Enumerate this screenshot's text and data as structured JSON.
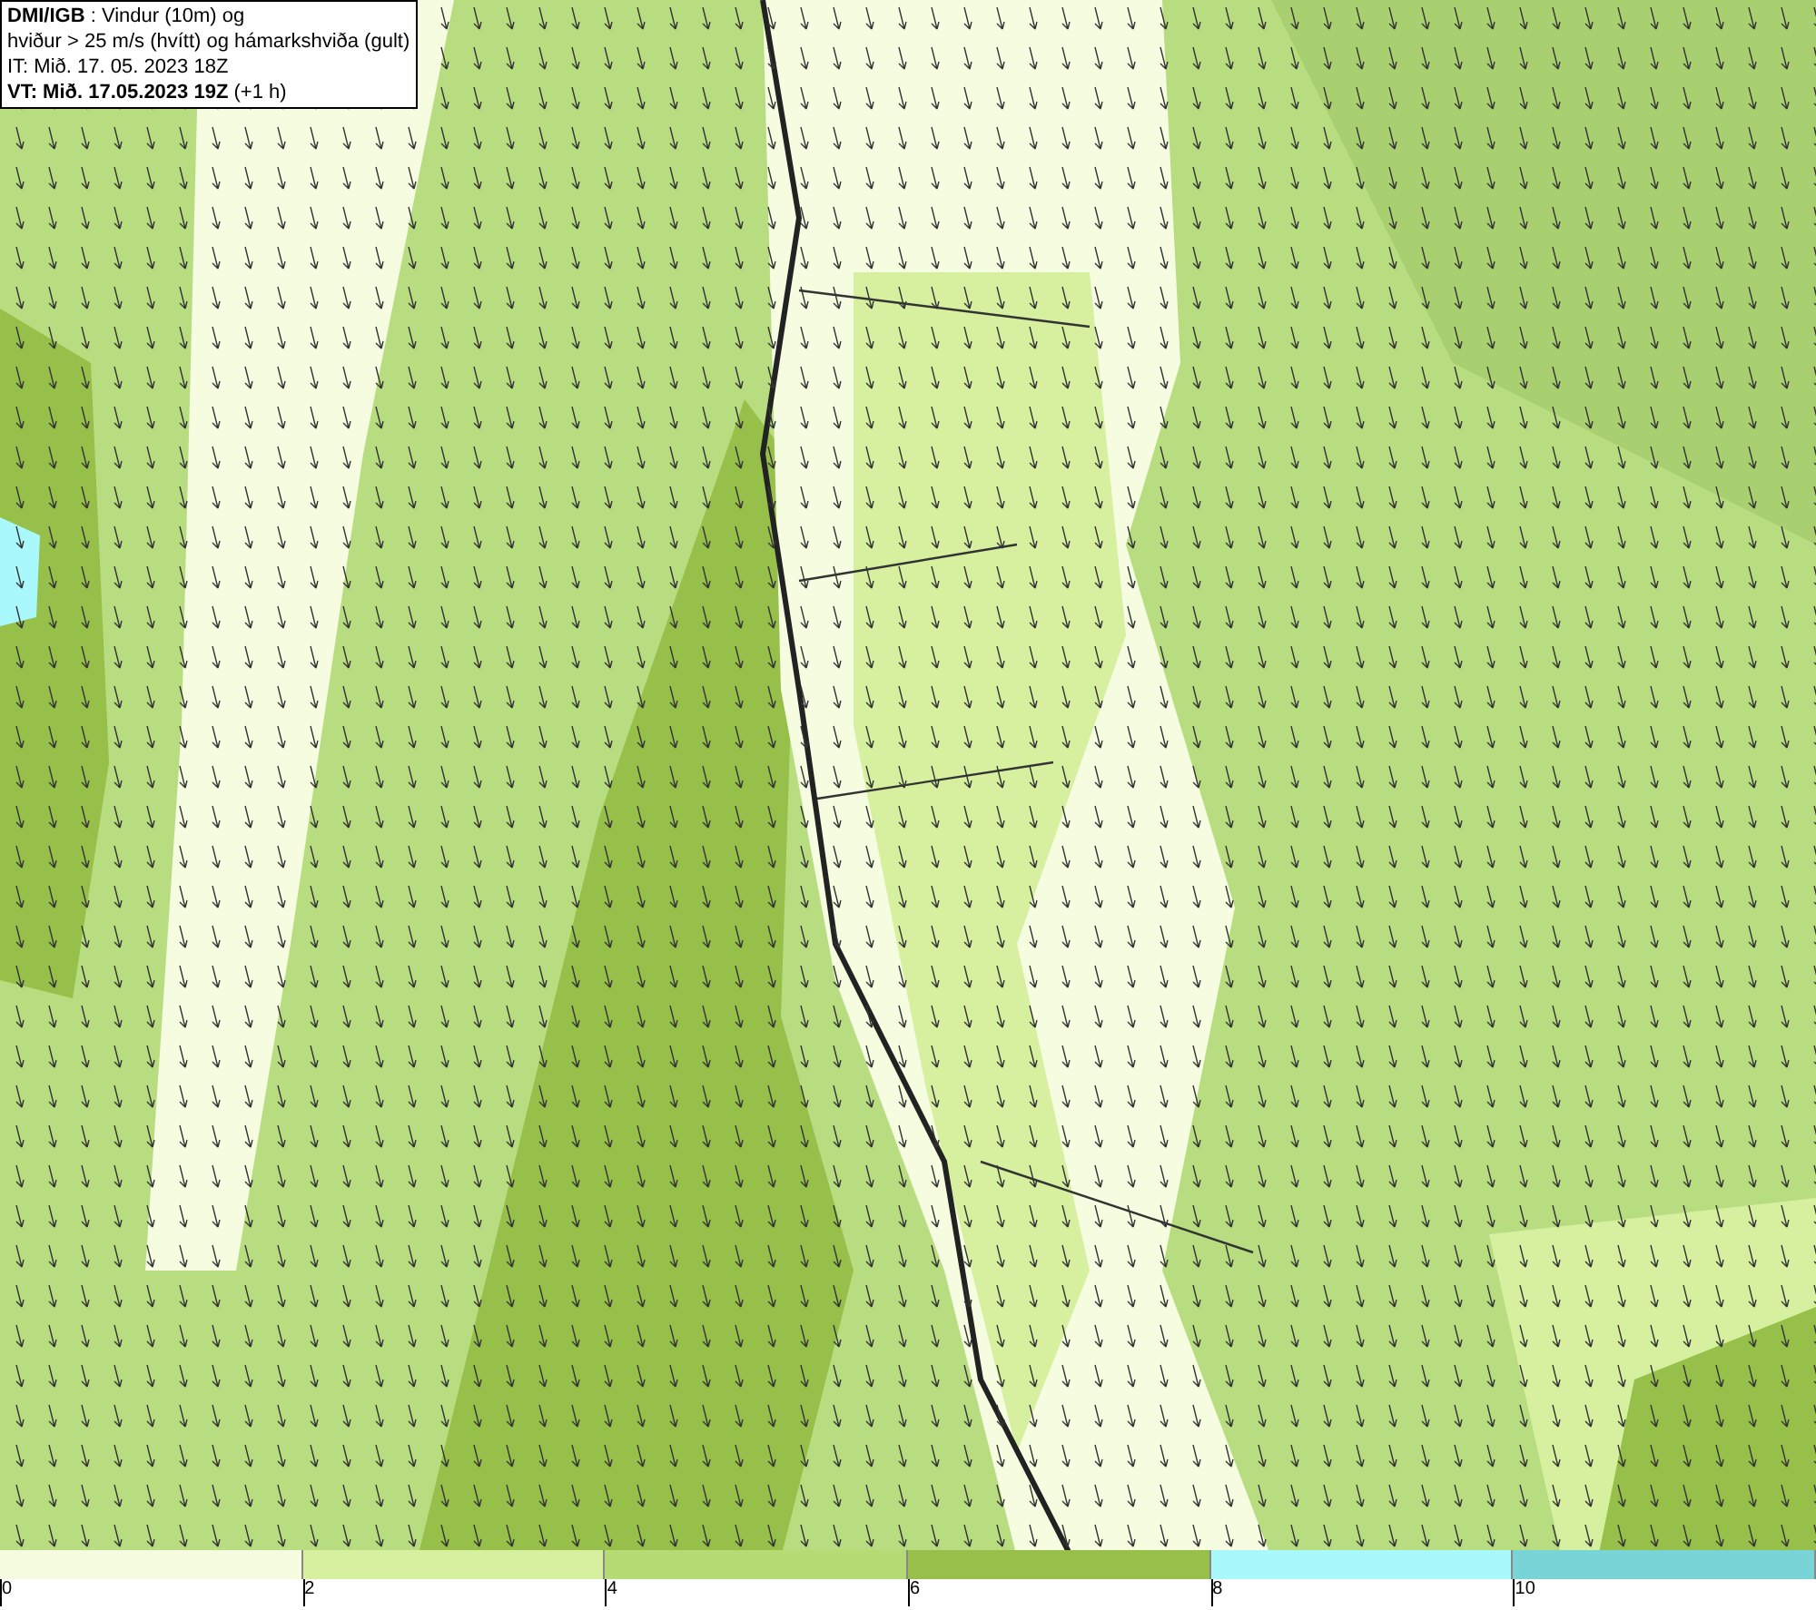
{
  "title_box": {
    "lines": [
      "**DMI/IGB** : Vindur (10m) og",
      "hviður > 25 m/s (hvítt) og hámarkshviða (gult)",
      "IT: Mið. 17. 05. 2023 18Z",
      "**VT: Mið. 17.05.2023 19Z** (+1 h)"
    ]
  },
  "legend": {
    "bins": [
      {
        "label": "0",
        "color": "#f5fce0"
      },
      {
        "label": "2",
        "color": "#d6f0a0"
      },
      {
        "label": "4",
        "color": "#b5db74"
      },
      {
        "label": "6",
        "color": "#96c04a"
      },
      {
        "label": "8",
        "color": "#a8f8fc"
      },
      {
        "label": "10",
        "color": "#78d4d6"
      }
    ]
  }
}
